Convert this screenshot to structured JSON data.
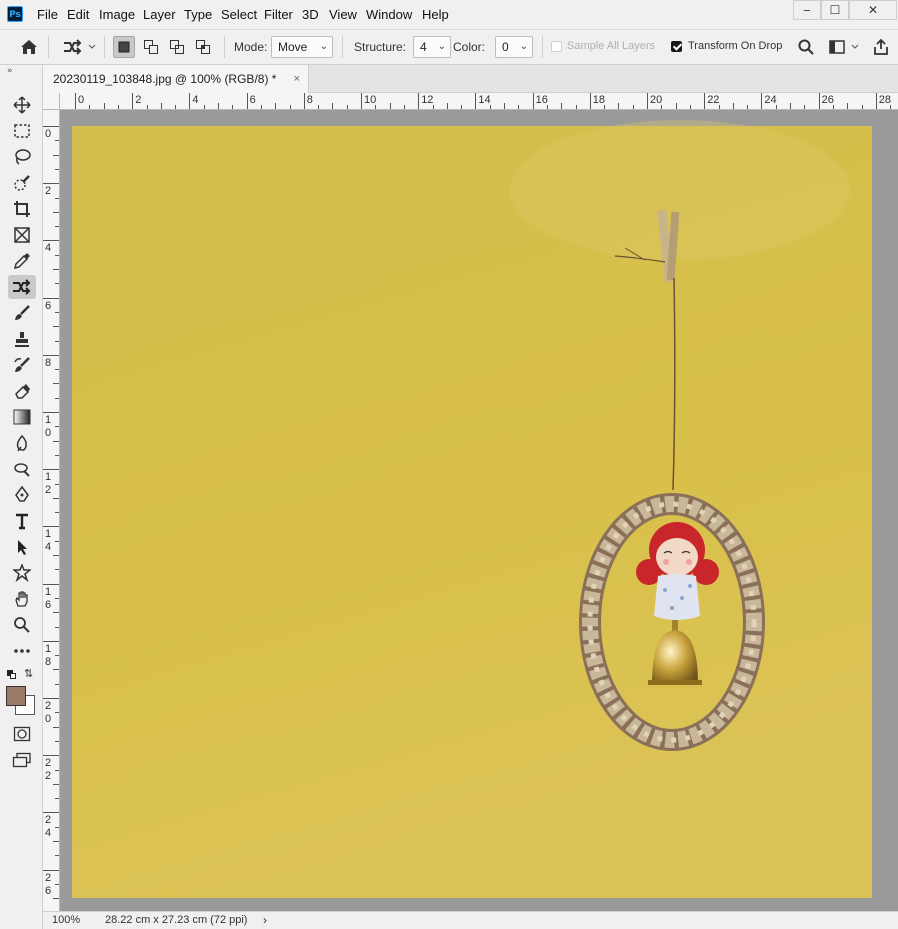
{
  "app": {
    "logo_text": "Ps"
  },
  "menu": [
    "File",
    "Edit",
    "Image",
    "Layer",
    "Type",
    "Select",
    "Filter",
    "3D",
    "View",
    "Window",
    "Help"
  ],
  "window_controls": {
    "minimize": "‒",
    "maximize": "☐",
    "close": "✕"
  },
  "options": {
    "mode_label": "Mode:",
    "mode_value": "Move",
    "structure_label": "Structure:",
    "structure_value": "4",
    "color_label": "Color:",
    "color_value": "0",
    "sample_all_layers": "Sample All Layers",
    "sample_all_layers_checked": false,
    "transform_on_drop": "Transform On Drop",
    "transform_on_drop_checked": true
  },
  "document_tab": {
    "title": "20230119_103848.jpg @ 100% (RGB/8) *",
    "close": "×"
  },
  "rulers": {
    "horizontal": [
      "0",
      "2",
      "4",
      "6",
      "8",
      "10",
      "12",
      "14",
      "16",
      "18",
      "20",
      "22",
      "24",
      "26",
      "28"
    ],
    "vertical": [
      [
        "0"
      ],
      [
        "2"
      ],
      [
        "4"
      ],
      [
        "6"
      ],
      [
        "8"
      ],
      [
        "1",
        "0"
      ],
      [
        "1",
        "2"
      ],
      [
        "1",
        "4"
      ],
      [
        "1",
        "6"
      ],
      [
        "1",
        "8"
      ],
      [
        "2",
        "0"
      ],
      [
        "2",
        "2"
      ],
      [
        "2",
        "4"
      ],
      [
        "2",
        "6"
      ]
    ]
  },
  "tools": [
    "move-tool",
    "marquee-tool",
    "lasso-tool",
    "quick-select-tool",
    "crop-tool",
    "frame-tool",
    "eyedropper-tool",
    "content-aware-move-tool",
    "brush-tool",
    "stamp-tool",
    "history-brush-tool",
    "eraser-tool",
    "gradient-tool",
    "blur-tool",
    "dodge-tool",
    "pen-tool",
    "type-tool",
    "path-select-tool",
    "shape-tool",
    "hand-tool",
    "zoom-tool",
    "more-tools"
  ],
  "colors": {
    "foreground": "#9b7b68",
    "background": "#ffffff",
    "canvas_bg": "#d8c04a"
  },
  "status": {
    "zoom": "100%",
    "doc_size": "28.22 cm x 27.23 cm (72 ppi)",
    "arrow": "›"
  }
}
